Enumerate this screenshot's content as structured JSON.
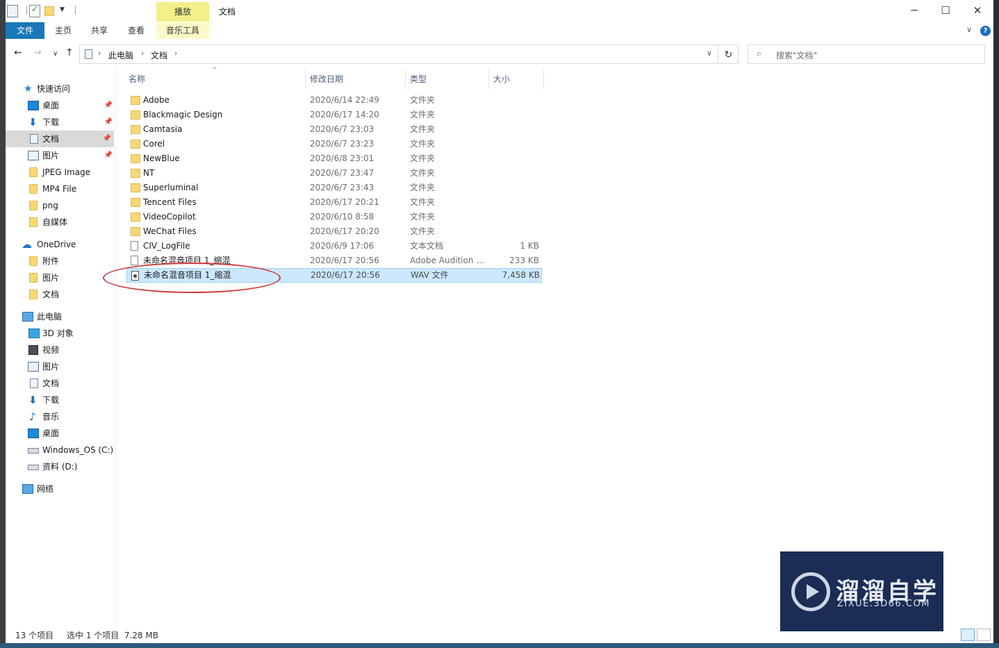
{
  "window": {
    "title": "文档",
    "contextual_tab_header": "播放"
  },
  "ribbon": {
    "tabs": [
      "文件",
      "主页",
      "共享",
      "查看",
      "音乐工具"
    ]
  },
  "address": {
    "crumbs": [
      "此电脑",
      "文档"
    ]
  },
  "search": {
    "placeholder": "搜索\"文档\""
  },
  "nav": {
    "quick_access": "快速访问",
    "quick_items": [
      "桌面",
      "下载",
      "文档",
      "图片",
      "JPEG Image",
      "MP4 File",
      "png",
      "自媒体"
    ],
    "onedrive": "OneDrive",
    "onedrive_items": [
      "附件",
      "图片",
      "文档"
    ],
    "this_pc": "此电脑",
    "pc_items": [
      "3D 对象",
      "视频",
      "图片",
      "文档",
      "下载",
      "音乐",
      "桌面",
      "Windows_OS (C:)",
      "资料 (D:)"
    ],
    "network": "网络"
  },
  "columns": {
    "name": "名称",
    "date": "修改日期",
    "type": "类型",
    "size": "大小"
  },
  "files": [
    {
      "name": "Adobe",
      "date": "2020/6/14 22:49",
      "type": "文件夹",
      "size": "",
      "icon": "folder-icon"
    },
    {
      "name": "Blackmagic Design",
      "date": "2020/6/17 14:20",
      "type": "文件夹",
      "size": "",
      "icon": "folder-icon"
    },
    {
      "name": "Camtasia",
      "date": "2020/6/7 23:03",
      "type": "文件夹",
      "size": "",
      "icon": "folder-icon"
    },
    {
      "name": "Corel",
      "date": "2020/6/7 23:23",
      "type": "文件夹",
      "size": "",
      "icon": "folder-icon"
    },
    {
      "name": "NewBlue",
      "date": "2020/6/8 23:01",
      "type": "文件夹",
      "size": "",
      "icon": "folder-icon"
    },
    {
      "name": "NT",
      "date": "2020/6/7 23:47",
      "type": "文件夹",
      "size": "",
      "icon": "folder-icon"
    },
    {
      "name": "Superluminal",
      "date": "2020/6/7 23:43",
      "type": "文件夹",
      "size": "",
      "icon": "folder-icon"
    },
    {
      "name": "Tencent Files",
      "date": "2020/6/17 20:21",
      "type": "文件夹",
      "size": "",
      "icon": "folder-icon"
    },
    {
      "name": "VideoCopilot",
      "date": "2020/6/10 8:58",
      "type": "文件夹",
      "size": "",
      "icon": "folder-icon"
    },
    {
      "name": "WeChat Files",
      "date": "2020/6/17 20:20",
      "type": "文件夹",
      "size": "",
      "icon": "folder-icon"
    },
    {
      "name": "CIV_LogFile",
      "date": "2020/6/9 17:06",
      "type": "文本文档",
      "size": "1 KB",
      "icon": "text-file-icon"
    },
    {
      "name": "未命名混音项目 1_缩混",
      "date": "2020/6/17 20:56",
      "type": "Adobe Audition ...",
      "size": "233 KB",
      "icon": "audition-file-icon"
    },
    {
      "name": "未命名混音项目 1_缩混",
      "date": "2020/6/17 20:56",
      "type": "WAV 文件",
      "size": "7,458 KB",
      "icon": "wav-file-icon",
      "selected": true
    }
  ],
  "status": {
    "count": "13 个项目",
    "selection": "选中 1 个项目  7.28 MB"
  },
  "watermark": {
    "title": "溜溜自学",
    "subtitle": "ZIXUE.3D66.COM"
  },
  "colors": {
    "accent": "#1979b8",
    "selection": "#cce8ff",
    "annotation": "#d0393d"
  }
}
